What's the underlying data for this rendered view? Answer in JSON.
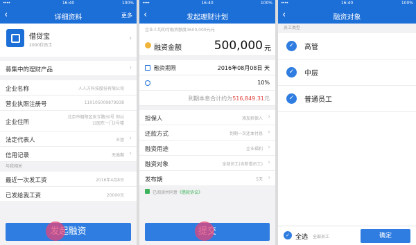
{
  "status": {
    "signal": "••••",
    "time": "16:40",
    "battery": "100%"
  },
  "screen1": {
    "title": "详细资料",
    "more": "更多",
    "company": {
      "name": "借贷宝",
      "sub": "2000位员工"
    },
    "products_label": "募集中的理财产品",
    "fields": [
      {
        "label": "企业名称",
        "value": "人人方科技股份有限公司"
      },
      {
        "label": "营业执照注册号",
        "value": "110105009879938"
      },
      {
        "label": "企业住所",
        "value": "北京市朝阳区安立路30号 仰山公园东一门2号楼"
      },
      {
        "label": "法定代表人",
        "value": "王旭"
      },
      {
        "label": "信用记录",
        "value": "无逾期"
      }
    ],
    "section_label": "与我相关",
    "related": [
      {
        "label": "最近一次发工资",
        "value": "2016年4月8日"
      },
      {
        "label": "已发给我工资",
        "value": "20000元"
      }
    ],
    "button": "发起融资"
  },
  "screen2": {
    "title": "发起理财计划",
    "hint": "企业人均的可融资额度3600,000元元",
    "amount_label": "融资金额",
    "amount_value": "500,000",
    "amount_unit": "元",
    "date_label": "融资期限",
    "date_value": "2016年08月08日 天",
    "rate_value": "10%",
    "total_prefix": "到期本息合计约为",
    "total_value": "516,849.31",
    "total_unit": "元",
    "fields": [
      {
        "label": "担保人",
        "value": "添加担保人"
      },
      {
        "label": "还款方式",
        "value": "到期一次还本付息"
      },
      {
        "label": "融资用途",
        "value": "企业福利"
      },
      {
        "label": "融资对象",
        "value": "全部员工(含新借员工)"
      },
      {
        "label": "发布期",
        "value": "5天"
      }
    ],
    "agree_text": "已阅读并同意",
    "agree_link": "《借款协议》",
    "button": "提交"
  },
  "screen3": {
    "title": "融资对象",
    "section_label": "员工类型",
    "options": [
      "高管",
      "中层",
      "普通员工"
    ],
    "select_all": "全选",
    "selected_text": "全部员工",
    "confirm": "确定"
  },
  "colors": {
    "primary": "#1d6fd8",
    "button": "#2f7de1",
    "accent_red": "#e0413d",
    "agree_green": "#3cb35a",
    "tap_highlight": "#e64678"
  }
}
